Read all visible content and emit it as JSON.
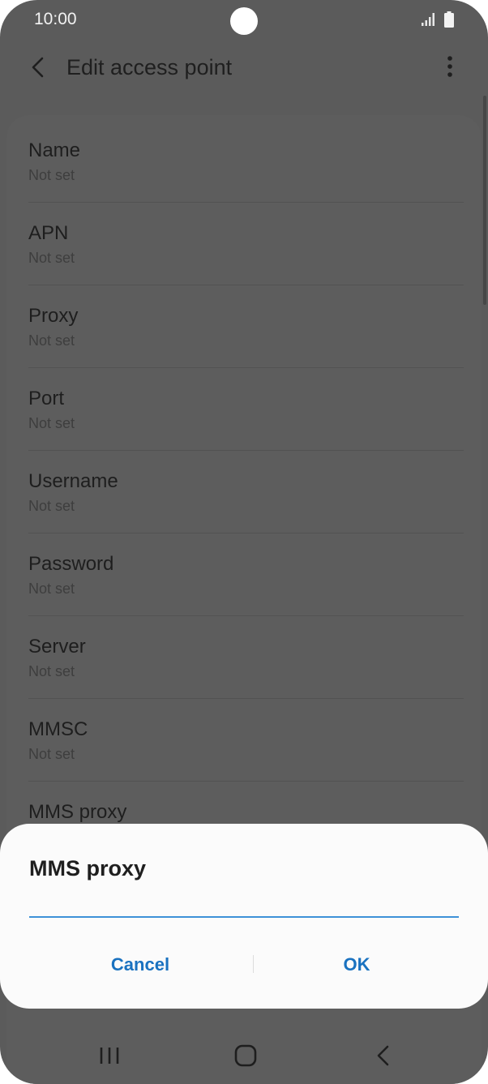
{
  "status_bar": {
    "time": "10:00",
    "icons": [
      "signal-icon",
      "battery-icon"
    ]
  },
  "app_bar": {
    "title": "Edit access point",
    "icons": [
      "back-arrow-icon",
      "more-options-icon"
    ]
  },
  "list": {
    "items": [
      {
        "title": "Name",
        "summary": "Not set"
      },
      {
        "title": "APN",
        "summary": "Not set"
      },
      {
        "title": "Proxy",
        "summary": "Not set"
      },
      {
        "title": "Port",
        "summary": "Not set"
      },
      {
        "title": "Username",
        "summary": "Not set"
      },
      {
        "title": "Password",
        "summary": "Not set"
      },
      {
        "title": "Server",
        "summary": "Not set"
      },
      {
        "title": "MMSC",
        "summary": "Not set"
      },
      {
        "title": "MMS proxy",
        "summary": ""
      }
    ]
  },
  "dialog": {
    "title": "MMS proxy",
    "input_value": "",
    "cancel_label": "Cancel",
    "ok_label": "OK"
  },
  "nav_bar": {
    "icons": [
      "recents-icon",
      "home-icon",
      "back-icon"
    ]
  },
  "colors": {
    "dim_background": "#5b5b5b",
    "dialog_background": "#fbfbfb",
    "accent": "#1a72c0",
    "input_underline": "#3e91d8"
  }
}
